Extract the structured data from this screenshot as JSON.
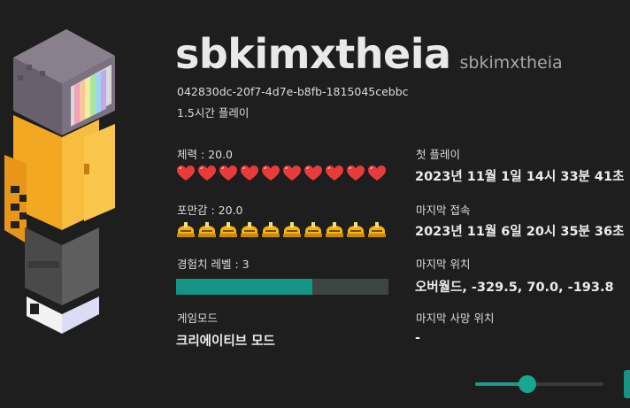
{
  "player": {
    "name": "sbkimxtheia",
    "subname": "sbkimxtheia",
    "uuid": "042830dc-20f7-4d7e-b8fb-1815045cebbc",
    "playtime": "1.5시간 플레이"
  },
  "stats": {
    "health_label": "체력 : 20.0",
    "health_icons": 10,
    "hunger_label": "포만감 : 20.0",
    "hunger_icons": 10,
    "xp_label": "경험치 레벨 : 3",
    "xp_progress": 0.64,
    "gamemode_label": "게임모드",
    "gamemode_value": "크리에이티브 모드"
  },
  "info": {
    "first_play_label": "첫 플레이",
    "first_play_value": "2023년 11월 1일 14시 33분 41초",
    "last_login_label": "마지막 접속",
    "last_login_value": "2023년 11월 6일 20시 35분 36초",
    "last_pos_label": "마지막 위치",
    "last_pos_value": "오버월드, -329.5, 70.0, -193.8",
    "death_pos_label": "마지막 사망 위치",
    "death_pos_value": "-"
  },
  "slider": {
    "value": 0.41
  },
  "colors": {
    "background": "#1e1e1e",
    "accent": "#139484",
    "heart": "#e83b3b",
    "hunger": "#f2b411"
  },
  "icons": {
    "health": "heart-icon",
    "hunger": "hunger-drumstick-icon"
  }
}
